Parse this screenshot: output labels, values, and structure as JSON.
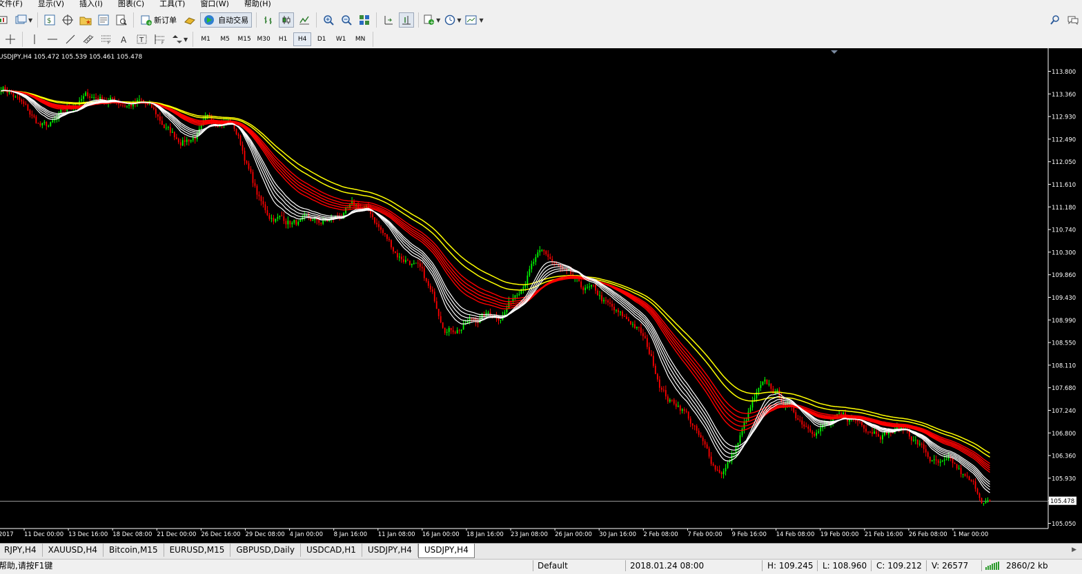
{
  "menu": [
    "文件(F)",
    "显示(V)",
    "插入(I)",
    "图表(C)",
    "工具(T)",
    "窗口(W)",
    "帮助(H)"
  ],
  "toolbar": {
    "new_order": "新订单",
    "auto_trading": "自动交易"
  },
  "timeframes": [
    "M1",
    "M5",
    "M15",
    "M30",
    "H1",
    "H4",
    "D1",
    "W1",
    "MN"
  ],
  "active_timeframe": "H4",
  "chart": {
    "header": "USDJPY,H4  105.472 105.539 105.461 105.478",
    "price_labels": [
      "113.800",
      "113.360",
      "112.930",
      "112.490",
      "112.050",
      "111.610",
      "111.180",
      "110.740",
      "110.300",
      "109.860",
      "109.430",
      "108.990",
      "108.550",
      "108.110",
      "107.680",
      "107.240",
      "106.800",
      "106.360",
      "105.930",
      "105.478",
      "105.050"
    ],
    "current_price": "105.478",
    "time_labels": [
      "2017",
      "11 Dec 00:00",
      "13 Dec 16:00",
      "18 Dec 08:00",
      "21 Dec 00:00",
      "26 Dec 16:00",
      "29 Dec 08:00",
      "4 Jan 00:00",
      "8 Jan 16:00",
      "11 Jan 08:00",
      "16 Jan 00:00",
      "18 Jan 16:00",
      "23 Jan 08:00",
      "26 Jan 00:00",
      "30 Jan 16:00",
      "2 Feb 08:00",
      "7 Feb 00:00",
      "9 Feb 16:00",
      "14 Feb 08:00",
      "19 Feb 00:00",
      "21 Feb 16:00",
      "26 Feb 08:00",
      "1 Mar 00:00"
    ],
    "colors": {
      "background": "#000000",
      "bull": "#00ff00",
      "bear": "#ff0000",
      "ma_fast": "#ffffff",
      "ma_mid": "#ff0000",
      "ma_slow": "#ffff00",
      "grid_text": "#ffffff"
    }
  },
  "chart_data": {
    "type": "line",
    "symbol": "USDJPY",
    "timeframe": "H4",
    "ohlc_last": {
      "open": 105.472,
      "high": 105.539,
      "low": 105.461,
      "close": 105.478
    },
    "ylim": [
      105.05,
      113.8
    ],
    "x": [
      "11 Dec",
      "14 Dec",
      "20 Dec",
      "27 Dec",
      "2 Jan",
      "8 Jan",
      "11 Jan",
      "16 Jan",
      "19 Jan",
      "23 Jan",
      "26 Jan",
      "30 Jan",
      "2 Feb",
      "6 Feb",
      "9 Feb",
      "13 Feb",
      "16 Feb",
      "19 Feb",
      "22 Feb",
      "26 Feb",
      "28 Feb",
      "1 Mar",
      "2 Mar"
    ],
    "series": [
      {
        "values": [
          113.5,
          112.7,
          113.3,
          113.2,
          112.5,
          112.9,
          111.0,
          110.8,
          111.1,
          110.2,
          108.9,
          109.1,
          110.2,
          109.5,
          108.9,
          107.4,
          106.1,
          107.6,
          107.0,
          107.0,
          106.9,
          106.1,
          105.48
        ]
      }
    ]
  },
  "tabs": [
    "RJPY,H4",
    "XAUUSD,H4",
    "Bitcoin,M15",
    "EURUSD,M15",
    "GBPUSD,Daily",
    "USDCAD,H1",
    "USDJPY,H4",
    "USDJPY,H4"
  ],
  "active_tab": 7,
  "status": {
    "help": "帮助,请按F1键",
    "profile": "Default",
    "datetime": "2018.01.24 08:00",
    "high": "H: 109.245",
    "low": "L: 108.960",
    "close": "C: 109.212",
    "volume": "V: 26577",
    "traffic": "2860/2 kb"
  }
}
